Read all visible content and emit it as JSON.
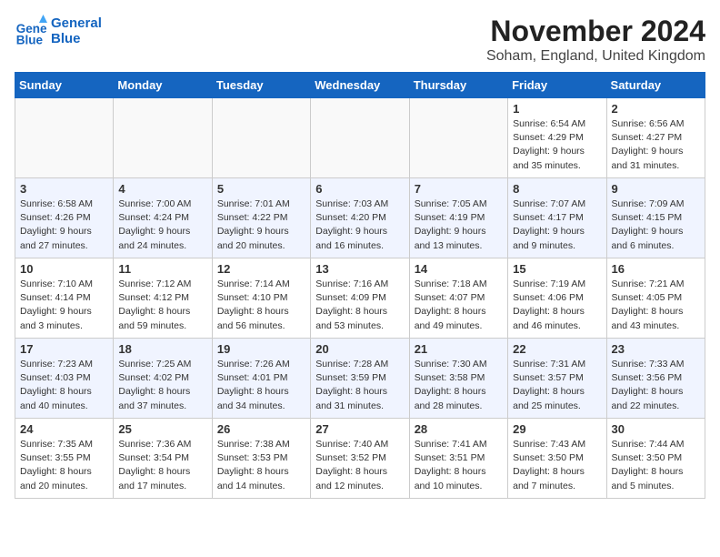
{
  "header": {
    "logo_line1": "General",
    "logo_line2": "Blue",
    "title": "November 2024",
    "location": "Soham, England, United Kingdom"
  },
  "days_of_week": [
    "Sunday",
    "Monday",
    "Tuesday",
    "Wednesday",
    "Thursday",
    "Friday",
    "Saturday"
  ],
  "weeks": [
    [
      {
        "day": "",
        "info": "",
        "empty": true
      },
      {
        "day": "",
        "info": "",
        "empty": true
      },
      {
        "day": "",
        "info": "",
        "empty": true
      },
      {
        "day": "",
        "info": "",
        "empty": true
      },
      {
        "day": "",
        "info": "",
        "empty": true
      },
      {
        "day": "1",
        "info": "Sunrise: 6:54 AM\nSunset: 4:29 PM\nDaylight: 9 hours\nand 35 minutes."
      },
      {
        "day": "2",
        "info": "Sunrise: 6:56 AM\nSunset: 4:27 PM\nDaylight: 9 hours\nand 31 minutes."
      }
    ],
    [
      {
        "day": "3",
        "info": "Sunrise: 6:58 AM\nSunset: 4:26 PM\nDaylight: 9 hours\nand 27 minutes."
      },
      {
        "day": "4",
        "info": "Sunrise: 7:00 AM\nSunset: 4:24 PM\nDaylight: 9 hours\nand 24 minutes."
      },
      {
        "day": "5",
        "info": "Sunrise: 7:01 AM\nSunset: 4:22 PM\nDaylight: 9 hours\nand 20 minutes."
      },
      {
        "day": "6",
        "info": "Sunrise: 7:03 AM\nSunset: 4:20 PM\nDaylight: 9 hours\nand 16 minutes."
      },
      {
        "day": "7",
        "info": "Sunrise: 7:05 AM\nSunset: 4:19 PM\nDaylight: 9 hours\nand 13 minutes."
      },
      {
        "day": "8",
        "info": "Sunrise: 7:07 AM\nSunset: 4:17 PM\nDaylight: 9 hours\nand 9 minutes."
      },
      {
        "day": "9",
        "info": "Sunrise: 7:09 AM\nSunset: 4:15 PM\nDaylight: 9 hours\nand 6 minutes."
      }
    ],
    [
      {
        "day": "10",
        "info": "Sunrise: 7:10 AM\nSunset: 4:14 PM\nDaylight: 9 hours\nand 3 minutes."
      },
      {
        "day": "11",
        "info": "Sunrise: 7:12 AM\nSunset: 4:12 PM\nDaylight: 8 hours\nand 59 minutes."
      },
      {
        "day": "12",
        "info": "Sunrise: 7:14 AM\nSunset: 4:10 PM\nDaylight: 8 hours\nand 56 minutes."
      },
      {
        "day": "13",
        "info": "Sunrise: 7:16 AM\nSunset: 4:09 PM\nDaylight: 8 hours\nand 53 minutes."
      },
      {
        "day": "14",
        "info": "Sunrise: 7:18 AM\nSunset: 4:07 PM\nDaylight: 8 hours\nand 49 minutes."
      },
      {
        "day": "15",
        "info": "Sunrise: 7:19 AM\nSunset: 4:06 PM\nDaylight: 8 hours\nand 46 minutes."
      },
      {
        "day": "16",
        "info": "Sunrise: 7:21 AM\nSunset: 4:05 PM\nDaylight: 8 hours\nand 43 minutes."
      }
    ],
    [
      {
        "day": "17",
        "info": "Sunrise: 7:23 AM\nSunset: 4:03 PM\nDaylight: 8 hours\nand 40 minutes."
      },
      {
        "day": "18",
        "info": "Sunrise: 7:25 AM\nSunset: 4:02 PM\nDaylight: 8 hours\nand 37 minutes."
      },
      {
        "day": "19",
        "info": "Sunrise: 7:26 AM\nSunset: 4:01 PM\nDaylight: 8 hours\nand 34 minutes."
      },
      {
        "day": "20",
        "info": "Sunrise: 7:28 AM\nSunset: 3:59 PM\nDaylight: 8 hours\nand 31 minutes."
      },
      {
        "day": "21",
        "info": "Sunrise: 7:30 AM\nSunset: 3:58 PM\nDaylight: 8 hours\nand 28 minutes."
      },
      {
        "day": "22",
        "info": "Sunrise: 7:31 AM\nSunset: 3:57 PM\nDaylight: 8 hours\nand 25 minutes."
      },
      {
        "day": "23",
        "info": "Sunrise: 7:33 AM\nSunset: 3:56 PM\nDaylight: 8 hours\nand 22 minutes."
      }
    ],
    [
      {
        "day": "24",
        "info": "Sunrise: 7:35 AM\nSunset: 3:55 PM\nDaylight: 8 hours\nand 20 minutes."
      },
      {
        "day": "25",
        "info": "Sunrise: 7:36 AM\nSunset: 3:54 PM\nDaylight: 8 hours\nand 17 minutes."
      },
      {
        "day": "26",
        "info": "Sunrise: 7:38 AM\nSunset: 3:53 PM\nDaylight: 8 hours\nand 14 minutes."
      },
      {
        "day": "27",
        "info": "Sunrise: 7:40 AM\nSunset: 3:52 PM\nDaylight: 8 hours\nand 12 minutes."
      },
      {
        "day": "28",
        "info": "Sunrise: 7:41 AM\nSunset: 3:51 PM\nDaylight: 8 hours\nand 10 minutes."
      },
      {
        "day": "29",
        "info": "Sunrise: 7:43 AM\nSunset: 3:50 PM\nDaylight: 8 hours\nand 7 minutes."
      },
      {
        "day": "30",
        "info": "Sunrise: 7:44 AM\nSunset: 3:50 PM\nDaylight: 8 hours\nand 5 minutes."
      }
    ]
  ],
  "alt_rows": [
    1,
    3
  ]
}
